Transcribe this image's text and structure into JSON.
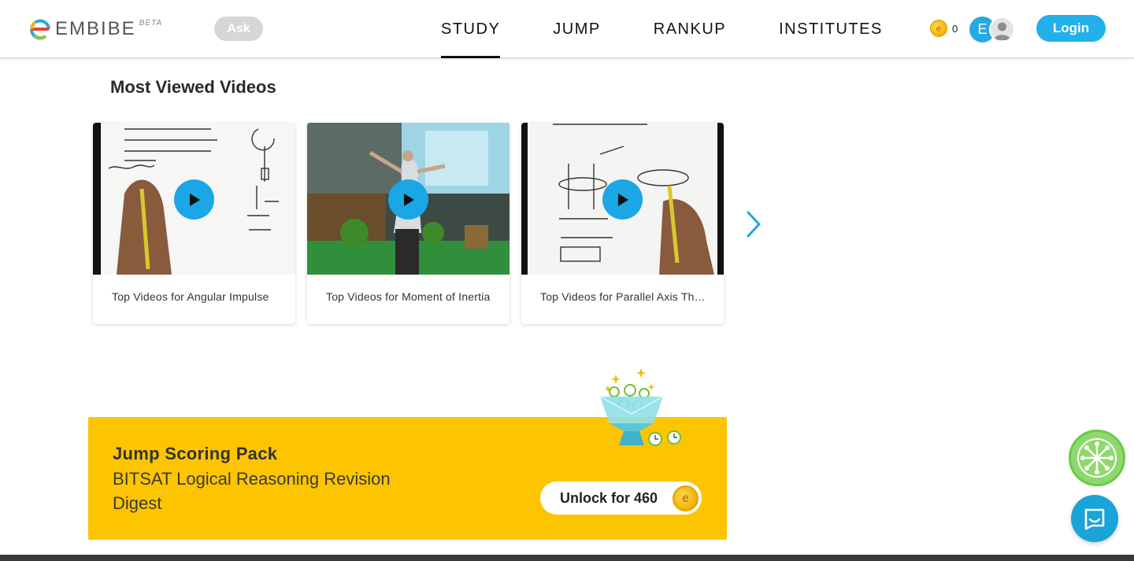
{
  "header": {
    "logo_text": "EMBIBE",
    "logo_badge": "BETA",
    "ask_label": "Ask",
    "nav": [
      {
        "label": "STUDY",
        "active": true
      },
      {
        "label": "JUMP",
        "active": false
      },
      {
        "label": "RANKUP",
        "active": false
      },
      {
        "label": "INSTITUTES",
        "active": false
      }
    ],
    "coin_count": "0",
    "avatar_initial": "E",
    "login_label": "Login"
  },
  "videos": {
    "section_title": "Most Viewed Videos",
    "items": [
      {
        "title": "Top Videos for Angular Impulse"
      },
      {
        "title": "Top Videos for Moment of Inertia"
      },
      {
        "title": "Top Videos for Parallel Axis Theorem"
      }
    ],
    "next_icon": "chevron-right-icon"
  },
  "pack": {
    "title": "Jump Scoring Pack",
    "subtitle": "BITSAT Logical Reasoning Revision Digest",
    "unlock_label": "Unlock for 460",
    "coin_icon_letter": "e"
  },
  "colors": {
    "brand_blue": "#22b0eb",
    "banner_yellow": "#fdc500",
    "play_blue": "#1ba6e6"
  }
}
